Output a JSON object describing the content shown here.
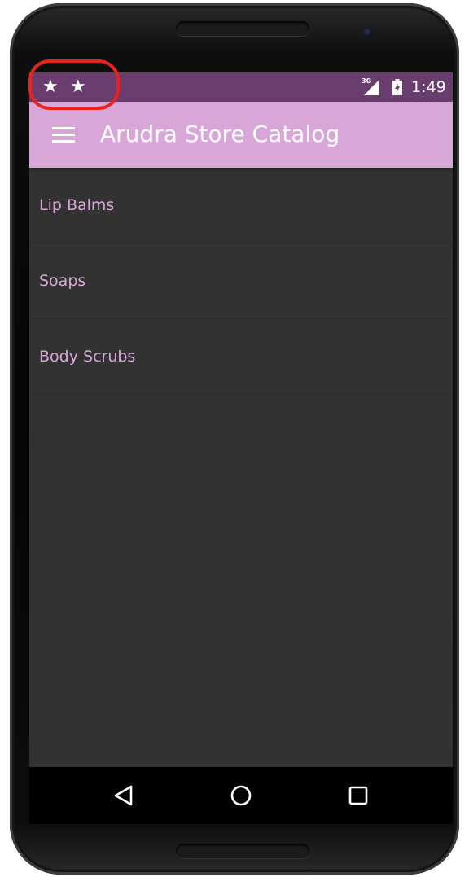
{
  "status_bar": {
    "notification_icons": [
      "star-icon",
      "star-icon"
    ],
    "network_label": "3G",
    "time": "1:49",
    "color": "#6a3d6f"
  },
  "app_bar": {
    "menu_icon": "hamburger-menu-icon",
    "title": "Arudra Store Catalog",
    "color": "#d8a7d8"
  },
  "list": {
    "items": [
      {
        "label": "Lip Balms"
      },
      {
        "label": "Soaps"
      },
      {
        "label": "Body Scrubs"
      }
    ],
    "text_color": "#d8a7d8",
    "background": "#323232"
  },
  "nav_bar": {
    "buttons": [
      "back-icon",
      "home-icon",
      "recent-apps-icon"
    ]
  },
  "annotation": {
    "color": "#e8231f",
    "shape": "rounded-rectangle highlight around status bar notification icons"
  }
}
